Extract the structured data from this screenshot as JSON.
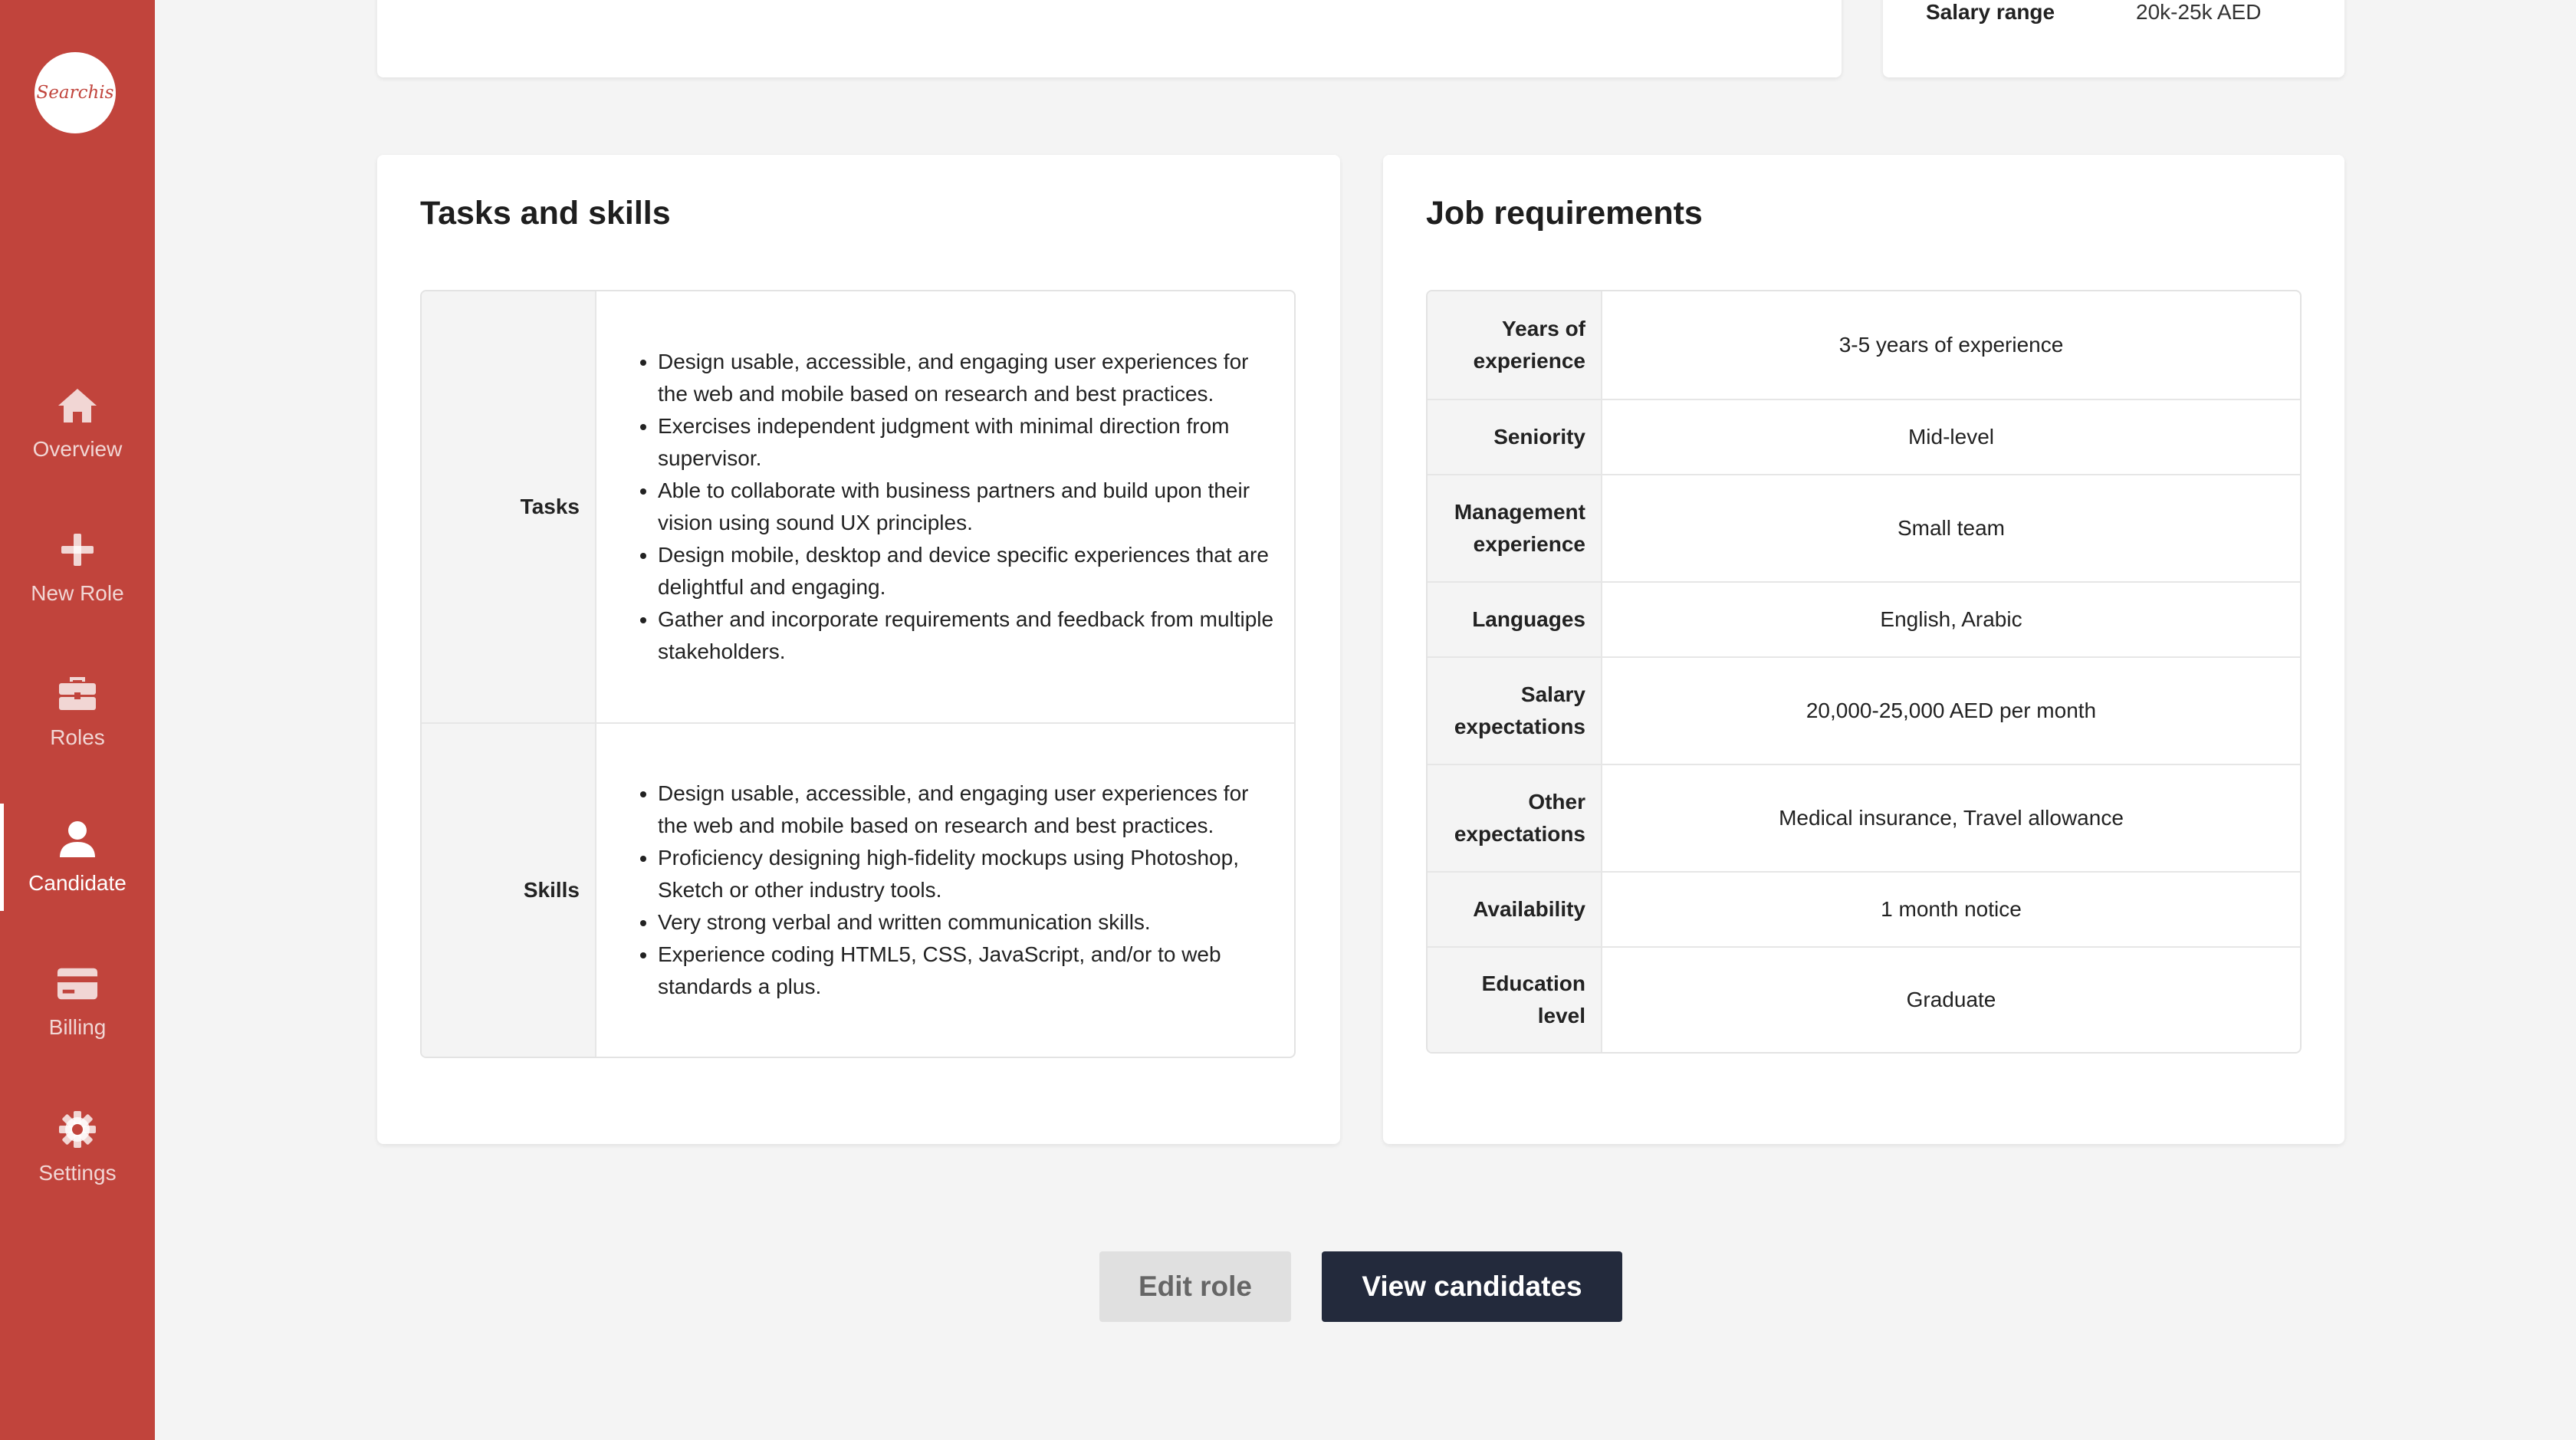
{
  "colors": {
    "brand": "#c1443c",
    "primary_button": "#232a3c",
    "secondary_button": "#e0e0e0",
    "background": "#f4f4f4"
  },
  "sidebar": {
    "logo_text": "Searchis",
    "items": [
      {
        "label": "Overview",
        "icon": "home-icon",
        "active": false
      },
      {
        "label": "New Role",
        "icon": "plus-icon",
        "active": false
      },
      {
        "label": "Roles",
        "icon": "briefcase-icon",
        "active": false
      },
      {
        "label": "Candidate",
        "icon": "user-icon",
        "active": true
      },
      {
        "label": "Billing",
        "icon": "credit-card-icon",
        "active": false
      },
      {
        "label": "Settings",
        "icon": "gear-icon",
        "active": false
      }
    ]
  },
  "top_card": {
    "salary_label": "Salary range",
    "salary_value": "20k-25k AED"
  },
  "tasks_skills": {
    "title": "Tasks and skills",
    "tasks_label": "Tasks",
    "tasks": [
      "Design usable, accessible, and engaging user experiences for the web and mobile based on research and best practices.",
      "Exercises independent judgment with minimal direction from supervisor.",
      "Able to collaborate with business partners and build upon their vision using sound UX principles.",
      "Design mobile, desktop and device specific experiences that are delightful and engaging.",
      "Gather and incorporate requirements and feedback from multiple stakeholders."
    ],
    "skills_label": "Skills",
    "skills": [
      "Design usable, accessible, and engaging user experiences for the web and mobile based on research and best practices.",
      "Proficiency designing high-fidelity mockups using Photoshop, Sketch or other industry tools.",
      "Very strong verbal and written communication skills.",
      "Experience coding HTML5, CSS, JavaScript, and/or to web standards a plus."
    ]
  },
  "job_requirements": {
    "title": "Job requirements",
    "rows": [
      {
        "label": "Years of experience",
        "value": "3-5 years of experience"
      },
      {
        "label": "Seniority",
        "value": "Mid-level"
      },
      {
        "label": "Management experience",
        "value": "Small team"
      },
      {
        "label": "Languages",
        "value": "English, Arabic"
      },
      {
        "label": "Salary expectations",
        "value": "20,000-25,000 AED per month"
      },
      {
        "label": "Other expectations",
        "value": "Medical insurance, Travel allowance"
      },
      {
        "label": "Availability",
        "value": "1 month notice"
      },
      {
        "label": "Education level",
        "value": "Graduate"
      }
    ]
  },
  "actions": {
    "edit_label": "Edit role",
    "view_label": "View candidates"
  }
}
